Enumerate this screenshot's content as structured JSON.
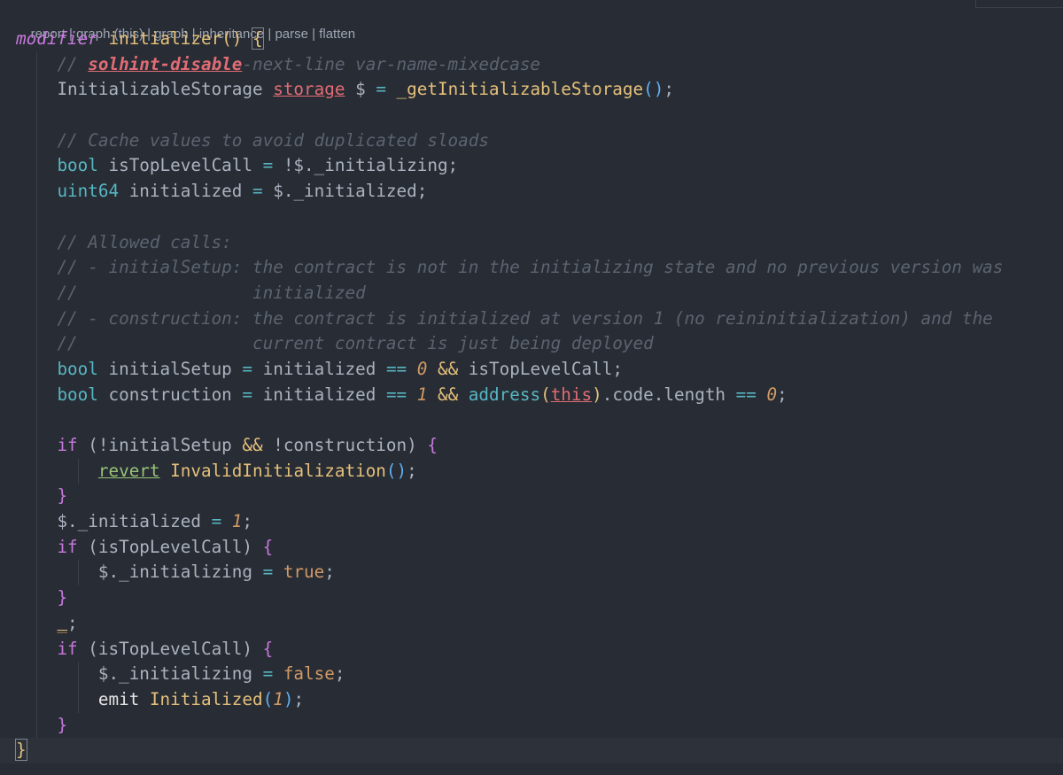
{
  "codelens": {
    "items": [
      "report",
      "graph (this)",
      "graph",
      "inheritance",
      "parse",
      "flatten"
    ],
    "separator": " | "
  },
  "code": {
    "l1": {
      "kw": "modifier",
      "name": "initializer",
      "parens": "()",
      "brace": "{"
    },
    "l2": {
      "c1": "// ",
      "err": "solhint-disable",
      "c2": "-next-line var-name-mixedcase"
    },
    "l3": {
      "type": "InitializableStorage",
      "storage": "storage",
      "rest": " $ ",
      "op": "=",
      "fn": "_getInitializableStorage",
      "paren": "()",
      "semi": ";"
    },
    "l5": {
      "comment": "// Cache values to avoid duplicated sloads"
    },
    "l6": {
      "type": "bool",
      "name": " isTopLevelCall ",
      "op": "=",
      "rest": " !$._initializing;"
    },
    "l7": {
      "type": "uint64",
      "name": " initialized ",
      "op": "=",
      "rest": " $._initialized;"
    },
    "l9": {
      "comment": "// Allowed calls:"
    },
    "l10": {
      "comment": "// - initialSetup: the contract is not in the initializing state and no previous version was"
    },
    "l11": {
      "comment": "//                 initialized"
    },
    "l12": {
      "comment": "// - construction: the contract is initialized at version 1 (no reininitialization) and the"
    },
    "l13": {
      "comment": "//                 current contract is just being deployed"
    },
    "l14": {
      "type": "bool",
      "name": " initialSetup ",
      "op": "=",
      "v1": " initialized ",
      "eq": "==",
      "num": " 0",
      "and": " &&",
      "rest": " isTopLevelCall;"
    },
    "l15": {
      "type": "bool",
      "name": " construction ",
      "op": "=",
      "v1": " initialized ",
      "eq": "==",
      "num": " 1",
      "and": " &&",
      "addr": " address",
      "p1": "(",
      "this": "this",
      "p2": ")",
      "mid": ".code.length ",
      "eq2": "==",
      "num2": " 0",
      "semi": ";"
    },
    "l17": {
      "kw": "if",
      "open": " (!initialSetup ",
      "and": "&&",
      "close": " !construction) ",
      "brace": "{"
    },
    "l18": {
      "revert": "revert",
      "fn": " InvalidInitialization",
      "paren": "()",
      "semi": ";"
    },
    "l19": {
      "brace": "}"
    },
    "l20": {
      "var": "$._initialized ",
      "op": "=",
      "num": " 1",
      "semi": ";"
    },
    "l21": {
      "kw": "if",
      "rest": " (isTopLevelCall) ",
      "brace": "{"
    },
    "l22": {
      "var": "$._initializing ",
      "op": "=",
      "val": " true",
      "semi": ";"
    },
    "l23": {
      "brace": "}"
    },
    "l24": {
      "under": "_",
      "semi": ";"
    },
    "l25": {
      "kw": "if",
      "rest": " (isTopLevelCall) ",
      "brace": "{"
    },
    "l26": {
      "var": "$._initializing ",
      "op": "=",
      "val": " false",
      "semi": ";"
    },
    "l27": {
      "emit": "emit",
      "fn": " Initialized",
      "p1": "(",
      "num": "1",
      "p2": ")",
      "semi": ";"
    },
    "l28": {
      "brace": "}"
    },
    "l29": {
      "brace": "}"
    }
  }
}
